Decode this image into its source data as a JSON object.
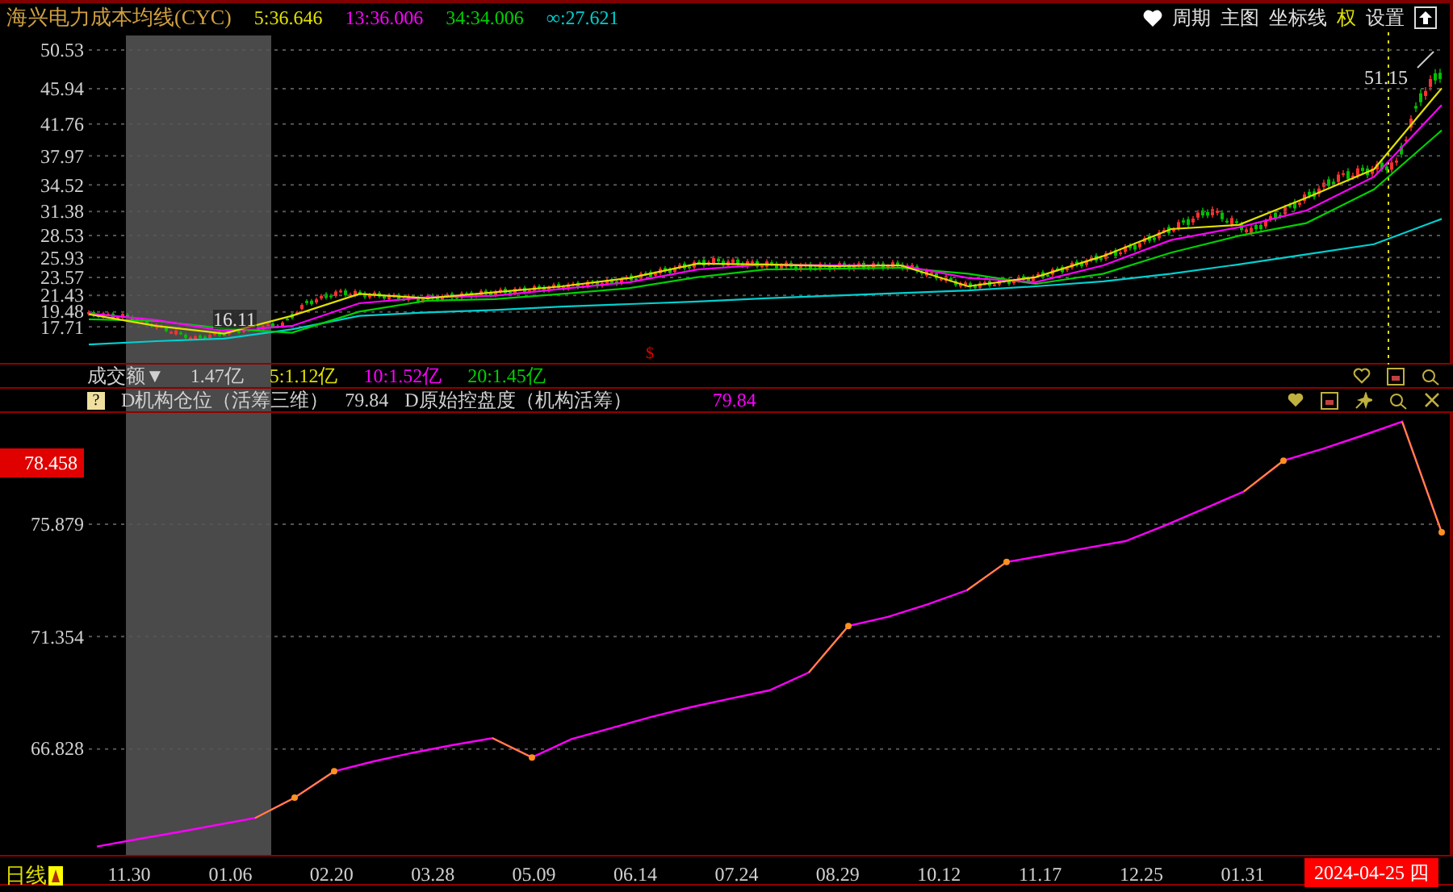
{
  "header": {
    "title": "海兴电力成本均线(CYC)",
    "legend": [
      {
        "text": "5:36.646",
        "color": "#e0e000"
      },
      {
        "text": "13:36.006",
        "color": "#ff00ff"
      },
      {
        "text": "34:34.006",
        "color": "#00d000"
      },
      {
        "text": "∞:27.621",
        "color": "#00d0d0"
      }
    ],
    "toolbar": [
      {
        "label": "周期",
        "highlighted": false
      },
      {
        "label": "主图",
        "highlighted": false
      },
      {
        "label": "坐标线",
        "highlighted": false
      },
      {
        "label": "权",
        "highlighted": true
      },
      {
        "label": "设置",
        "highlighted": false
      }
    ]
  },
  "price_chart": {
    "high_label": "51.15",
    "low_label": "16.11",
    "marker": "$",
    "chart_data": {
      "type": "line",
      "categories": [
        null,
        null,
        null,
        null,
        null,
        null,
        null,
        null,
        null,
        null,
        null,
        null,
        null,
        null,
        null,
        null,
        null,
        null,
        null,
        null,
        null
      ],
      "ylim": [
        13.23,
        52.63
      ],
      "grid": true,
      "yticks": [
        {
          "value": 50.53,
          "label": "50.53"
        },
        {
          "value": 45.94,
          "label": "45.94"
        },
        {
          "value": 41.76,
          "label": "41.76"
        },
        {
          "value": 37.97,
          "label": "37.97"
        },
        {
          "value": 34.52,
          "label": "34.52"
        },
        {
          "value": 31.38,
          "label": "31.38"
        },
        {
          "value": 28.53,
          "label": "28.53"
        },
        {
          "value": 25.93,
          "label": "25.93"
        },
        {
          "value": 23.57,
          "label": "23.57"
        },
        {
          "value": 21.43,
          "label": "21.43"
        },
        {
          "value": 19.48,
          "label": "19.48"
        },
        {
          "value": 17.71,
          "label": "17.71"
        }
      ],
      "series": [
        {
          "color": "#00d0d0",
          "values": [
            15.6,
            16.0,
            16.3,
            17.4,
            19.0,
            19.4,
            19.7,
            20.1,
            20.4,
            20.7,
            21.1,
            21.4,
            21.7,
            22.0,
            22.5,
            23.1,
            24.0,
            25.1,
            26.3,
            27.5,
            30.5
          ]
        },
        {
          "color": "#00d000",
          "values": [
            18.6,
            18.4,
            17.5,
            17.0,
            19.5,
            20.8,
            21.0,
            21.6,
            22.3,
            23.6,
            24.5,
            24.6,
            24.7,
            24.0,
            22.8,
            24.0,
            26.5,
            28.5,
            30.0,
            34.0,
            41.0
          ]
        },
        {
          "color": "#ff00ff",
          "values": [
            19.3,
            18.5,
            17.2,
            17.8,
            20.5,
            21.2,
            21.4,
            22.2,
            23.0,
            24.5,
            25.1,
            25.0,
            25.0,
            23.5,
            23.0,
            25.0,
            28.0,
            29.5,
            31.5,
            35.5,
            44.0
          ]
        },
        {
          "color": "#e0e000",
          "values": [
            19.2,
            17.8,
            16.9,
            19.0,
            21.6,
            21.1,
            21.8,
            22.5,
            23.5,
            25.2,
            25.1,
            24.9,
            25.0,
            22.5,
            23.6,
            26.1,
            29.3,
            29.8,
            33.0,
            36.4,
            46.0
          ]
        }
      ]
    }
  },
  "volume_bar": {
    "title": "成交额▼",
    "value": "1.47亿",
    "averages": [
      {
        "text": "5:1.12亿",
        "color": "#e0e000"
      },
      {
        "text": "10:1.52亿",
        "color": "#ff00ff"
      },
      {
        "text": "20:1.45亿",
        "color": "#00d000"
      }
    ]
  },
  "indicator_bar": {
    "help": "?",
    "name": "D机构仓位（活筹三维）",
    "value": "79.84",
    "name2": "D原始控盘度（机构活筹）",
    "value2": "79.84"
  },
  "indicator_chart": {
    "current_label": "78.458",
    "chart_data": {
      "type": "line",
      "categories": [
        null,
        null,
        null,
        null,
        null,
        null,
        null,
        null,
        null,
        null,
        null,
        null,
        null,
        null,
        null,
        null,
        null,
        null,
        null,
        null,
        null,
        null,
        null,
        null,
        null,
        null,
        null,
        null,
        null,
        null,
        null,
        null,
        null,
        null,
        null
      ],
      "ylim": [
        62.5,
        80.36
      ],
      "grid": true,
      "yticks": [
        {
          "value": 75.879,
          "label": "75.879"
        },
        {
          "value": 71.354,
          "label": "71.354"
        },
        {
          "value": 66.828,
          "label": "66.828"
        }
      ],
      "series": [
        {
          "color": "#ff00ff",
          "values": [
            62.9,
            63.19,
            63.47,
            63.76,
            64.05,
            64.87,
            65.93,
            66.33,
            66.68,
            66.99,
            67.27,
            66.49,
            67.23,
            67.67,
            68.11,
            68.51,
            68.85,
            69.19,
            69.91,
            71.78,
            72.15,
            72.65,
            73.22,
            74.36,
            74.64,
            74.92,
            75.2,
            75.83,
            76.51,
            77.2,
            78.44,
            78.92,
            79.45,
            80.01,
            75.55
          ]
        }
      ]
    }
  },
  "time_axis": {
    "period": "日线",
    "dates": [
      "11.30",
      "01.06",
      "02.20",
      "03.28",
      "05.09",
      "06.14",
      "07.24",
      "08.29",
      "10.12",
      "11.17",
      "12.25",
      "01.31"
    ],
    "current_date": "2024-04-25 四"
  }
}
